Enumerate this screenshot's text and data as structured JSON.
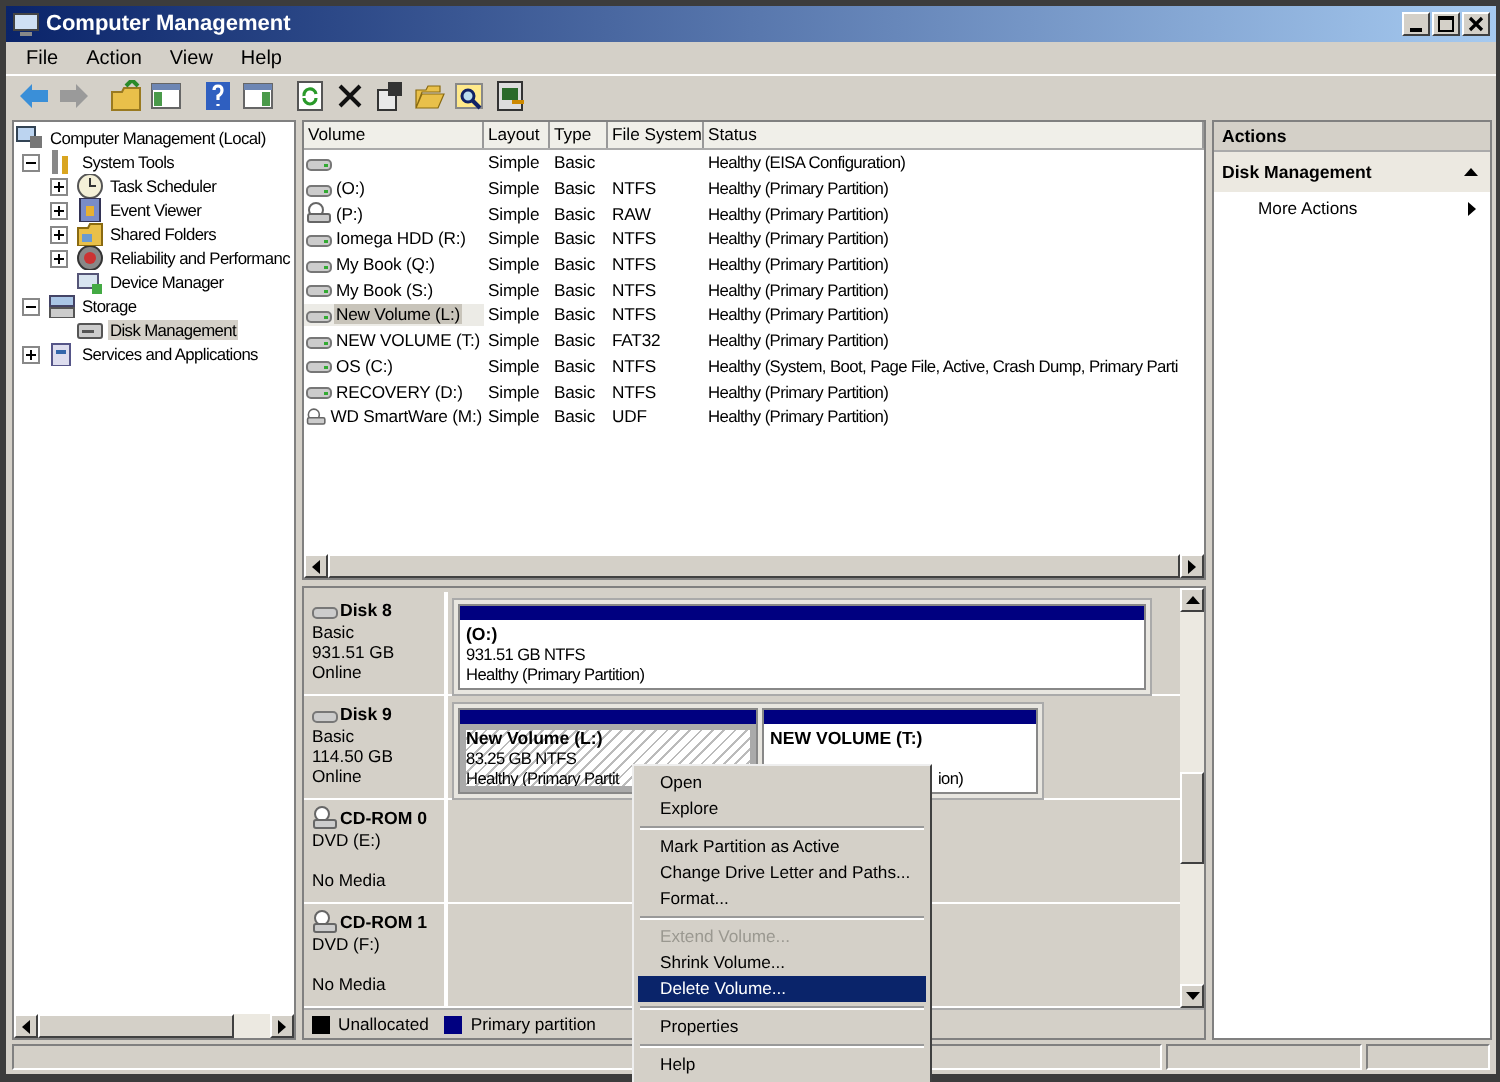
{
  "window": {
    "title": "Computer Management"
  },
  "menu": [
    "File",
    "Action",
    "View",
    "Help"
  ],
  "tree": [
    {
      "label": "Computer Management (Local)",
      "children": [
        {
          "label": "System Tools",
          "expanded": true,
          "children": [
            {
              "label": "Task Scheduler",
              "expanded": false
            },
            {
              "label": "Event Viewer",
              "expanded": false
            },
            {
              "label": "Shared Folders",
              "expanded": false
            },
            {
              "label": "Reliability and Performanc",
              "expanded": false
            },
            {
              "label": "Device Manager"
            }
          ]
        },
        {
          "label": "Storage",
          "expanded": true,
          "children": [
            {
              "label": "Disk Management",
              "selected": true
            }
          ]
        },
        {
          "label": "Services and Applications",
          "expanded": false
        }
      ]
    }
  ],
  "volume_table": {
    "columns": [
      "Volume",
      "Layout",
      "Type",
      "File System",
      "Status"
    ],
    "rows": [
      {
        "kind": "disk",
        "volume": "",
        "layout": "Simple",
        "type": "Basic",
        "fs": "",
        "status": "Healthy (EISA Configuration)",
        "selected": false
      },
      {
        "kind": "disk",
        "volume": "(O:)",
        "layout": "Simple",
        "type": "Basic",
        "fs": "NTFS",
        "status": "Healthy (Primary Partition)",
        "selected": false
      },
      {
        "kind": "optical",
        "volume": "(P:)",
        "layout": "Simple",
        "type": "Basic",
        "fs": "RAW",
        "status": "Healthy (Primary Partition)",
        "selected": false
      },
      {
        "kind": "disk",
        "volume": "Iomega HDD (R:)",
        "layout": "Simple",
        "type": "Basic",
        "fs": "NTFS",
        "status": "Healthy (Primary Partition)",
        "selected": false
      },
      {
        "kind": "disk",
        "volume": "My Book (Q:)",
        "layout": "Simple",
        "type": "Basic",
        "fs": "NTFS",
        "status": "Healthy (Primary Partition)",
        "selected": false
      },
      {
        "kind": "disk",
        "volume": "My Book (S:)",
        "layout": "Simple",
        "type": "Basic",
        "fs": "NTFS",
        "status": "Healthy (Primary Partition)",
        "selected": false
      },
      {
        "kind": "disk",
        "volume": "New Volume (L:)",
        "layout": "Simple",
        "type": "Basic",
        "fs": "NTFS",
        "status": "Healthy (Primary Partition)",
        "selected": true
      },
      {
        "kind": "disk",
        "volume": "NEW VOLUME (T:)",
        "layout": "Simple",
        "type": "Basic",
        "fs": "FAT32",
        "status": "Healthy (Primary Partition)",
        "selected": false
      },
      {
        "kind": "disk",
        "volume": "OS (C:)",
        "layout": "Simple",
        "type": "Basic",
        "fs": "NTFS",
        "status": "Healthy (System, Boot, Page File, Active, Crash Dump, Primary Parti",
        "selected": false
      },
      {
        "kind": "disk",
        "volume": "RECOVERY (D:)",
        "layout": "Simple",
        "type": "Basic",
        "fs": "NTFS",
        "status": "Healthy (Primary Partition)",
        "selected": false
      },
      {
        "kind": "optical",
        "volume": "WD SmartWare (M:)",
        "layout": "Simple",
        "type": "Basic",
        "fs": "UDF",
        "status": "Healthy (Primary Partition)",
        "selected": false
      }
    ]
  },
  "disks": [
    {
      "kind": "disk",
      "name": "Disk 8",
      "lines": [
        "Basic",
        "931.51 GB",
        "Online"
      ],
      "partitions": [
        {
          "name": "(O:)",
          "size": "931.51 GB NTFS",
          "status": "Healthy (Primary Partition)",
          "selected": false
        }
      ]
    },
    {
      "kind": "disk",
      "name": "Disk 9",
      "lines": [
        "Basic",
        "114.50 GB",
        "Online"
      ],
      "partitions": [
        {
          "name": "New Volume  (L:)",
          "size": "83.25 GB NTFS",
          "status": "Healthy (Primary Partit",
          "selected": true
        },
        {
          "name": "NEW VOLUME  (T:)",
          "status": "ion)",
          "selected": false
        }
      ]
    },
    {
      "kind": "optical",
      "name": "CD-ROM 0",
      "lines": [
        "DVD (E:)",
        "No Media"
      ]
    },
    {
      "kind": "optical",
      "name": "CD-ROM 1",
      "lines": [
        "DVD (F:)",
        "No Media"
      ]
    }
  ],
  "legend": [
    {
      "label": "Unallocated",
      "color": "#000000"
    },
    {
      "label": "Primary partition",
      "color": "#000080"
    }
  ],
  "actions": {
    "title": "Actions",
    "section": "Disk Management",
    "items": [
      "More Actions"
    ]
  },
  "context_menu": [
    {
      "kind": "item",
      "label": "Open",
      "disabled": false,
      "selected": false
    },
    {
      "kind": "item",
      "label": "Explore",
      "disabled": false,
      "selected": false
    },
    {
      "kind": "separator"
    },
    {
      "kind": "item",
      "label": "Mark Partition as Active",
      "disabled": false,
      "selected": false
    },
    {
      "kind": "item",
      "label": "Change Drive Letter and Paths...",
      "disabled": false,
      "selected": false
    },
    {
      "kind": "item",
      "label": "Format...",
      "disabled": false,
      "selected": false
    },
    {
      "kind": "separator"
    },
    {
      "kind": "item",
      "label": "Extend Volume...",
      "disabled": true,
      "selected": false
    },
    {
      "kind": "item",
      "label": "Shrink Volume...",
      "disabled": false,
      "selected": false
    },
    {
      "kind": "item",
      "label": "Delete Volume...",
      "disabled": false,
      "selected": true
    },
    {
      "kind": "separator"
    },
    {
      "kind": "item",
      "label": "Properties",
      "disabled": false,
      "selected": false
    },
    {
      "kind": "separator"
    },
    {
      "kind": "item",
      "label": "Help",
      "disabled": false,
      "selected": false
    }
  ]
}
